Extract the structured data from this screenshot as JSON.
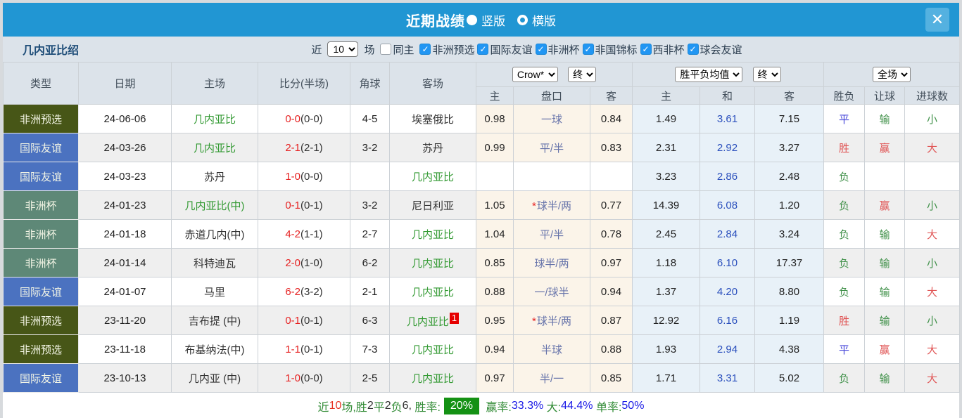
{
  "header": {
    "title": "近期战绩",
    "vertical_label": "竖版",
    "horizontal_label": "横版",
    "close_glyph": "✕",
    "bar_color": "#2196d3"
  },
  "filter": {
    "team_title": "几内亚比绍",
    "near_label": "近",
    "matches_value": "10",
    "matches_label": "场",
    "same_home_label": "同主",
    "same_home_checked": false,
    "check_glyph": "✓",
    "competitions": [
      {
        "label": "非洲预选",
        "checked": true
      },
      {
        "label": "国际友谊",
        "checked": true
      },
      {
        "label": "非洲杯",
        "checked": true
      },
      {
        "label": "非国锦标",
        "checked": true
      },
      {
        "label": "西非杯",
        "checked": true
      },
      {
        "label": "球会友谊",
        "checked": true
      }
    ]
  },
  "table": {
    "headers": [
      "类型",
      "日期",
      "主场",
      "比分(半场)",
      "角球",
      "客场"
    ],
    "selectors": {
      "company": "Crow*",
      "company_time": "终",
      "avg": "胜平负均值",
      "avg_time": "终",
      "scope": "全场"
    },
    "sub_headers": [
      "主",
      "盘口",
      "客",
      "主",
      "和",
      "客",
      "胜负",
      "让球",
      "进球数"
    ],
    "rows": [
      {
        "type": "非洲预选",
        "type_color": "#475617",
        "date": "24-06-06",
        "home": "几内亚比",
        "home_team": true,
        "score": "0-0",
        "half": "(0-0)",
        "corner": "4-5",
        "away": "埃塞俄比",
        "away_team": false,
        "badge": "",
        "ah_home": "0.98",
        "ah_star": false,
        "ah_line": "一球",
        "ah_away": "0.84",
        "avg_home": "1.49",
        "avg_draw": "3.61",
        "avg_away": "7.15",
        "result": "平",
        "result_c": "blue",
        "give": "输",
        "give_c": "green",
        "goals": "小",
        "goals_c": "green"
      },
      {
        "type": "国际友谊",
        "type_color": "#4b72c0",
        "date": "24-03-26",
        "home": "几内亚比",
        "home_team": true,
        "score": "2-1",
        "half": "(2-1)",
        "corner": "3-2",
        "away": "苏丹",
        "away_team": false,
        "badge": "",
        "ah_home": "0.99",
        "ah_star": false,
        "ah_line": "平/半",
        "ah_away": "0.83",
        "avg_home": "2.31",
        "avg_draw": "2.92",
        "avg_away": "3.27",
        "result": "胜",
        "result_c": "red",
        "give": "赢",
        "give_c": "red",
        "goals": "大",
        "goals_c": "red"
      },
      {
        "type": "国际友谊",
        "type_color": "#4b72c0",
        "date": "24-03-23",
        "home": "苏丹",
        "home_team": false,
        "score": "1-0",
        "half": "(0-0)",
        "corner": "",
        "away": "几内亚比",
        "away_team": true,
        "badge": "",
        "ah_home": "",
        "ah_star": false,
        "ah_line": "",
        "ah_away": "",
        "avg_home": "3.23",
        "avg_draw": "2.86",
        "avg_away": "2.48",
        "result": "负",
        "result_c": "green",
        "give": "",
        "give_c": "",
        "goals": "",
        "goals_c": ""
      },
      {
        "type": "非洲杯",
        "type_color": "#5e8877",
        "date": "24-01-23",
        "home": "几内亚比(中)",
        "home_team": true,
        "score": "0-1",
        "half": "(0-1)",
        "corner": "3-2",
        "away": "尼日利亚",
        "away_team": false,
        "badge": "",
        "ah_home": "1.05",
        "ah_star": true,
        "ah_line": "球半/两",
        "ah_away": "0.77",
        "avg_home": "14.39",
        "avg_draw": "6.08",
        "avg_away": "1.20",
        "result": "负",
        "result_c": "green",
        "give": "赢",
        "give_c": "red",
        "goals": "小",
        "goals_c": "green"
      },
      {
        "type": "非洲杯",
        "type_color": "#5e8877",
        "date": "24-01-18",
        "home": "赤道几内(中)",
        "home_team": false,
        "score": "4-2",
        "half": "(1-1)",
        "corner": "2-7",
        "away": "几内亚比",
        "away_team": true,
        "badge": "",
        "ah_home": "1.04",
        "ah_star": false,
        "ah_line": "平/半",
        "ah_away": "0.78",
        "avg_home": "2.45",
        "avg_draw": "2.84",
        "avg_away": "3.24",
        "result": "负",
        "result_c": "green",
        "give": "输",
        "give_c": "green",
        "goals": "大",
        "goals_c": "red"
      },
      {
        "type": "非洲杯",
        "type_color": "#5e8877",
        "date": "24-01-14",
        "home": "科特迪瓦",
        "home_team": false,
        "score": "2-0",
        "half": "(1-0)",
        "corner": "6-2",
        "away": "几内亚比",
        "away_team": true,
        "badge": "",
        "ah_home": "0.85",
        "ah_star": false,
        "ah_line": "球半/两",
        "ah_away": "0.97",
        "avg_home": "1.18",
        "avg_draw": "6.10",
        "avg_away": "17.37",
        "result": "负",
        "result_c": "green",
        "give": "输",
        "give_c": "green",
        "goals": "小",
        "goals_c": "green"
      },
      {
        "type": "国际友谊",
        "type_color": "#4b72c0",
        "date": "24-01-07",
        "home": "马里",
        "home_team": false,
        "score": "6-2",
        "half": "(3-2)",
        "corner": "2-1",
        "away": "几内亚比",
        "away_team": true,
        "badge": "",
        "ah_home": "0.88",
        "ah_star": false,
        "ah_line": "一/球半",
        "ah_away": "0.94",
        "avg_home": "1.37",
        "avg_draw": "4.20",
        "avg_away": "8.80",
        "result": "负",
        "result_c": "green",
        "give": "输",
        "give_c": "green",
        "goals": "大",
        "goals_c": "red"
      },
      {
        "type": "非洲预选",
        "type_color": "#475617",
        "date": "23-11-20",
        "home": "吉布提 (中)",
        "home_team": false,
        "score": "0-1",
        "half": "(0-1)",
        "corner": "6-3",
        "away": "几内亚比",
        "away_team": true,
        "badge": "1",
        "ah_home": "0.95",
        "ah_star": true,
        "ah_line": "球半/两",
        "ah_away": "0.87",
        "avg_home": "12.92",
        "avg_draw": "6.16",
        "avg_away": "1.19",
        "result": "胜",
        "result_c": "red",
        "give": "输",
        "give_c": "green",
        "goals": "小",
        "goals_c": "green"
      },
      {
        "type": "非洲预选",
        "type_color": "#475617",
        "date": "23-11-18",
        "home": "布基纳法(中)",
        "home_team": false,
        "score": "1-1",
        "half": "(0-1)",
        "corner": "7-3",
        "away": "几内亚比",
        "away_team": true,
        "badge": "",
        "ah_home": "0.94",
        "ah_star": false,
        "ah_line": "半球",
        "ah_away": "0.88",
        "avg_home": "1.93",
        "avg_draw": "2.94",
        "avg_away": "4.38",
        "result": "平",
        "result_c": "blue",
        "give": "赢",
        "give_c": "red",
        "goals": "大",
        "goals_c": "red"
      },
      {
        "type": "国际友谊",
        "type_color": "#4b72c0",
        "date": "23-10-13",
        "home": "几内亚 (中)",
        "home_team": false,
        "score": "1-0",
        "half": "(0-0)",
        "corner": "2-5",
        "away": "几内亚比",
        "away_team": true,
        "badge": "",
        "ah_home": "0.97",
        "ah_star": false,
        "ah_line": "半/一",
        "ah_away": "0.85",
        "avg_home": "1.71",
        "avg_draw": "3.31",
        "avg_away": "5.02",
        "result": "负",
        "result_c": "green",
        "give": "输",
        "give_c": "green",
        "goals": "大",
        "goals_c": "red"
      }
    ]
  },
  "footer": {
    "segments": [
      {
        "t": "近",
        "c": "green"
      },
      {
        "t": "10",
        "c": "red"
      },
      {
        "t": "场,胜",
        "c": "green"
      },
      {
        "t": "2",
        "c": "dark"
      },
      {
        "t": "平",
        "c": "green"
      },
      {
        "t": "2",
        "c": "dark"
      },
      {
        "t": "负",
        "c": "green"
      },
      {
        "t": "6, ",
        "c": "dark"
      },
      {
        "t": "胜率:",
        "c": "green"
      },
      {
        "t": "20%",
        "c": "badge"
      },
      {
        "t": " 赢率:",
        "c": "green"
      },
      {
        "t": "33.3%",
        "c": "blue"
      },
      {
        "t": " 大:",
        "c": "green"
      },
      {
        "t": "44.4%",
        "c": "blue"
      },
      {
        "t": " 单率:",
        "c": "green"
      },
      {
        "t": "50%",
        "c": "blue"
      }
    ]
  }
}
